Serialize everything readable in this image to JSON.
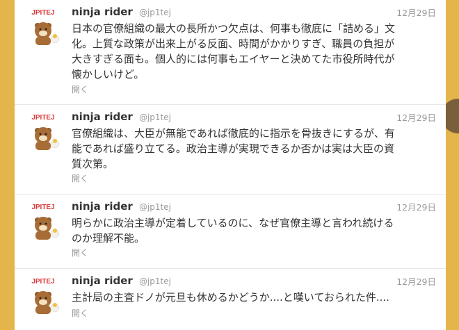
{
  "colors": {
    "page_bg": "#e3b54a",
    "name": "#333333",
    "meta": "#999999",
    "avatar_text": "#d93a3a"
  },
  "avatar_icon": "rilakkuma-bear-avatar",
  "avatar_caption": "JPITEJ",
  "tweets": [
    {
      "name": "ninja rider",
      "handle": "@jp1tej",
      "time": "12月29日",
      "lines": [
        "日本の官僚組織の最大の長所かつ欠点は、何事も徹底に「詰める」文",
        "化。上質な政策が出来上がる反面、時間がかかりすぎ、職員の負担が",
        "大きすぎる面も。個人的には何事もエイヤーと決めてた市役所時代が",
        "懐かしいけど。"
      ],
      "expand": "開く"
    },
    {
      "name": "ninja rider",
      "handle": "@jp1tej",
      "time": "12月29日",
      "lines": [
        "官僚組織は、大臣が無能であれば徹底的に指示を骨抜きにするが、有",
        "能であれば盛り立てる。政治主導が実現できるか否かは実は大臣の資",
        "質次第。"
      ],
      "expand": "開く"
    },
    {
      "name": "ninja rider",
      "handle": "@jp1tej",
      "time": "12月29日",
      "lines": [
        "明らかに政治主導が定着しているのに、なぜ官僚主導と言われ続ける",
        "のか理解不能。"
      ],
      "expand": "開く"
    },
    {
      "name": "ninja rider",
      "handle": "@jp1tej",
      "time": "12月29日",
      "lines": [
        "主計局の主査ドノが元旦も休めるかどうか....と嘆いておられた件...."
      ],
      "expand": "開く"
    }
  ]
}
